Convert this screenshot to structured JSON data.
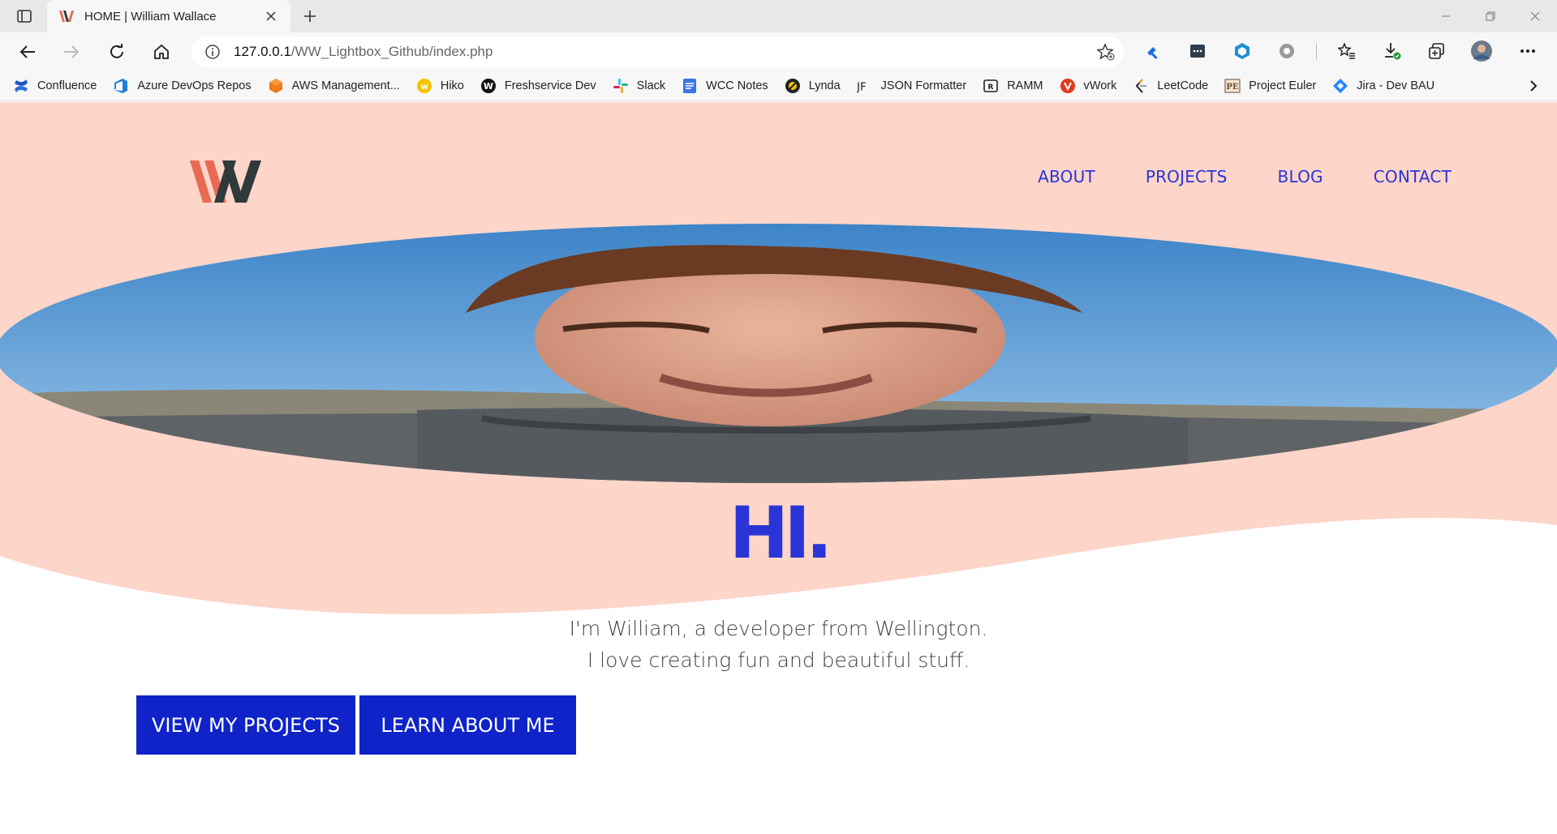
{
  "browser": {
    "tab": {
      "title": "HOME | William Wallace"
    },
    "address": {
      "host": "127.0.0.1",
      "path": "/WW_Lightbox_Github/index.php"
    },
    "bookmarks": [
      {
        "label": "Confluence",
        "icon": "confluence-icon",
        "color": "#2d6fd8"
      },
      {
        "label": "Azure DevOps Repos",
        "icon": "azure-devops-icon",
        "color": "#1e7fd6"
      },
      {
        "label": "AWS Management...",
        "icon": "aws-icon",
        "color": "#ef7a1a"
      },
      {
        "label": "Hiko",
        "icon": "hiko-icon",
        "color": "#f5c400"
      },
      {
        "label": "Freshservice Dev",
        "icon": "freshservice-icon",
        "color": "#111111"
      },
      {
        "label": "Slack",
        "icon": "slack-icon",
        "color": "#4a154b"
      },
      {
        "label": "WCC Notes",
        "icon": "docs-icon",
        "color": "#3b74e8"
      },
      {
        "label": "Lynda",
        "icon": "lynda-icon",
        "color": "#222222"
      },
      {
        "label": "JSON Formatter",
        "icon": "jf-icon",
        "color": "#222222"
      },
      {
        "label": "RAMM",
        "icon": "ramm-icon",
        "color": "#222222"
      },
      {
        "label": "vWork",
        "icon": "vwork-icon",
        "color": "#e03a1e"
      },
      {
        "label": "LeetCode",
        "icon": "leetcode-icon",
        "color": "#f89f1b"
      },
      {
        "label": "Project Euler",
        "icon": "project-euler-icon",
        "color": "#6b4a2b"
      },
      {
        "label": "Jira - Dev BAU",
        "icon": "jira-icon",
        "color": "#2684ff"
      }
    ]
  },
  "site": {
    "nav": [
      "ABOUT",
      "PROJECTS",
      "BLOG",
      "CONTACT"
    ],
    "hero_heading": "HI.",
    "intro_line1": "I'm William, a developer from Wellington.",
    "intro_line2": "I love creating fun and beautiful stuff.",
    "cta_projects": "VIEW MY PROJECTS",
    "cta_about": "LEARN ABOUT ME",
    "colors": {
      "hero_bg": "#fdd5c9",
      "accent": "#2b34d6",
      "button": "#0f23c9",
      "logo_red": "#e86a55",
      "logo_dark": "#2f3a3a"
    }
  }
}
